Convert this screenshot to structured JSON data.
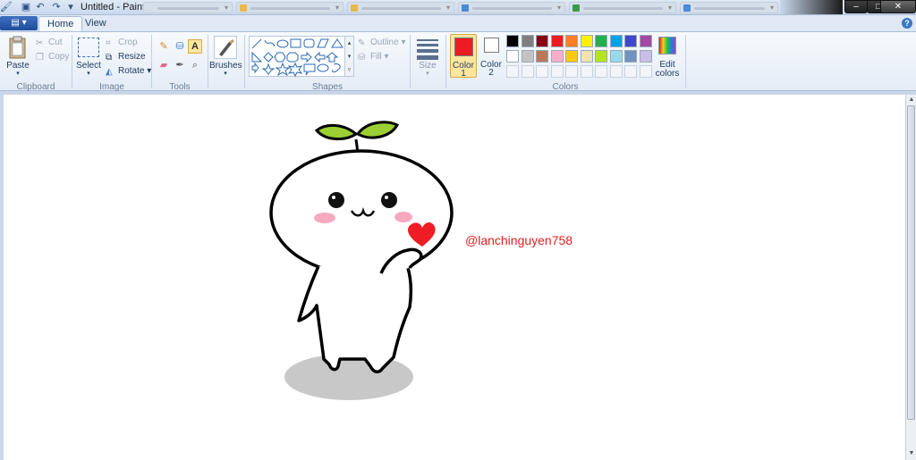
{
  "window": {
    "title": "Untitled - Paint",
    "controls": {
      "minimize": "–",
      "maximize": "□",
      "close": "✕"
    }
  },
  "quick_access": [
    "save-icon",
    "undo-icon",
    "redo-icon",
    "customize-icon"
  ],
  "menu": {
    "app_button": "▤ ▾"
  },
  "tabs": [
    {
      "label": "Home",
      "active": true
    },
    {
      "label": "View",
      "active": false
    }
  ],
  "help": "?",
  "ribbon": {
    "clipboard": {
      "group_label": "Clipboard",
      "paste": "Paste",
      "cut": "Cut",
      "copy": "Copy"
    },
    "image": {
      "group_label": "Image",
      "select": "Select",
      "crop": "Crop",
      "resize": "Resize",
      "rotate": "Rotate ▾"
    },
    "tools": {
      "group_label": "Tools",
      "text_tool": "A"
    },
    "brushes": {
      "label": "Brushes"
    },
    "shapes": {
      "group_label": "Shapes",
      "outline": "Outline ▾",
      "fill": "Fill ▾"
    },
    "size": {
      "label": "Size"
    },
    "colors": {
      "group_label": "Colors",
      "color1_label": "Color",
      "color1_num": "1",
      "color2_label": "Color",
      "color2_num": "2",
      "edit_label": "Edit",
      "edit_label2": "colors",
      "color1": "#ed1c24",
      "color2": "#ffffff",
      "palette_row1": [
        "#000000",
        "#7f7f7f",
        "#880015",
        "#ed1c24",
        "#ff7f27",
        "#fff200",
        "#22b14c",
        "#00a2e8",
        "#3f48cc",
        "#a349a4"
      ],
      "palette_row2": [
        "#ffffff",
        "#c3c3c3",
        "#b97a57",
        "#ffaec9",
        "#ffc90e",
        "#efe4b0",
        "#b5e61d",
        "#99d9ea",
        "#7092be",
        "#c8bfe7"
      ]
    }
  },
  "canvas": {
    "watermark": "@lanchinguyen758"
  }
}
